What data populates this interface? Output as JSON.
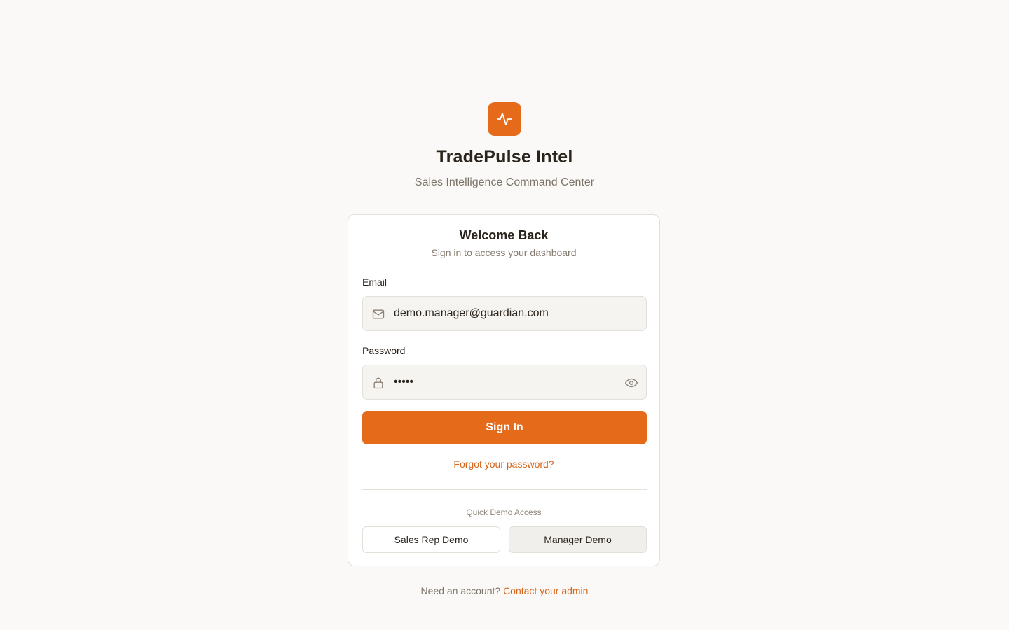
{
  "brand": {
    "name": "TradePulse Intel",
    "tagline": "Sales Intelligence Command Center",
    "logo_icon": "activity-pulse-icon",
    "accent_color": "#e56b1b"
  },
  "card": {
    "title": "Welcome Back",
    "subtitle": "Sign in to access your dashboard"
  },
  "form": {
    "email": {
      "label": "Email",
      "value": "demo.manager@guardian.com",
      "icon": "mail-icon"
    },
    "password": {
      "label": "Password",
      "value": "•••••",
      "icon": "lock-icon",
      "toggle_icon": "eye-icon"
    },
    "submit_label": "Sign In",
    "forgot_label": "Forgot your password?"
  },
  "quick_demo": {
    "label": "Quick Demo Access",
    "sales_rep_label": "Sales Rep Demo",
    "manager_label": "Manager Demo"
  },
  "footer": {
    "prompt": "Need an account?",
    "link_label": "Contact your admin"
  }
}
